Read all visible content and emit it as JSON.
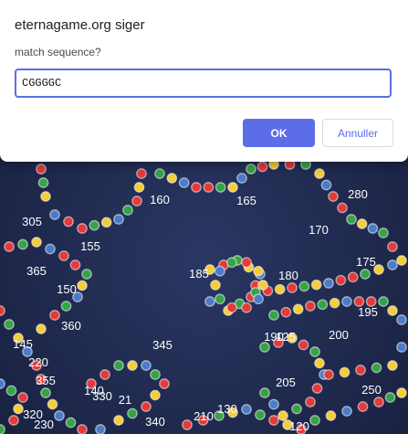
{
  "dialog": {
    "title": "eternagame.org siger",
    "message": "match sequence?",
    "input_value": "CGGGGC",
    "ok_label": "OK",
    "cancel_label": "Annuller"
  },
  "game": {
    "background_color": "#1c2545",
    "base_colors": {
      "G": "#e23b3b",
      "C": "#36a348",
      "A": "#f3cd3a",
      "U": "#4b7cc8"
    },
    "position_labels": [
      "280",
      "160",
      "165",
      "305",
      "155",
      "170",
      "365",
      "150",
      "185",
      "180",
      "175",
      "360",
      "195",
      "345",
      "190",
      "125",
      "200",
      "145",
      "220",
      "355",
      "205",
      "250",
      "140",
      "330",
      "21",
      "130",
      "210",
      "340",
      "230",
      "320",
      "120"
    ]
  }
}
